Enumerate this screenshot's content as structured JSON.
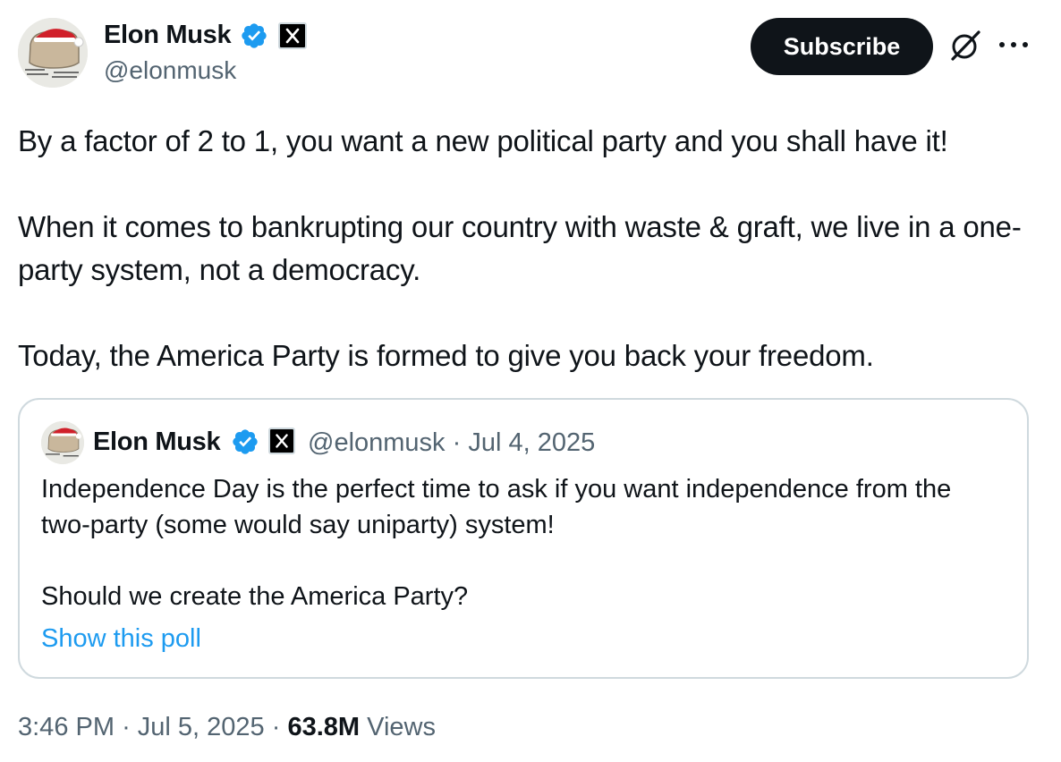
{
  "post": {
    "author": {
      "name": "Elon Musk",
      "handle": "@elonmusk",
      "avatar_icon": "avatar-santa-hat",
      "verified_icon": "verified-badge-icon",
      "affiliation_icon": "x-logo-icon"
    },
    "actions": {
      "subscribe_label": "Subscribe",
      "grok_icon": "grok-icon",
      "more_icon": "more-icon"
    },
    "text": {
      "paragraph_1": "By a factor of 2 to 1, you want a new political party and you shall have it!",
      "paragraph_2": "When it comes to bankrupting our country with waste & graft, we live in a one-party system, not a democracy.",
      "paragraph_3": "Today, the America Party is formed to give you back your freedom."
    },
    "quote": {
      "name": "Elon Musk",
      "handle": "@elonmusk",
      "separator": "·",
      "date": "Jul 4, 2025",
      "paragraph_1": "Independence Day is the perfect time to ask if you want independence from the two-party (some would say uniparty) system!",
      "paragraph_2": "Should we create the America Party?",
      "show_poll_label": "Show this poll"
    },
    "meta": {
      "time": "3:46 PM",
      "separator": "·",
      "date": "Jul 5, 2025",
      "views_count": "63.8M",
      "views_label": "Views"
    }
  },
  "colors": {
    "text_primary": "#0f1419",
    "text_secondary": "#536471",
    "link": "#1d9bf0",
    "verified": "#1d9bf0",
    "border": "#cfd9de",
    "button_bg": "#0f1419"
  }
}
